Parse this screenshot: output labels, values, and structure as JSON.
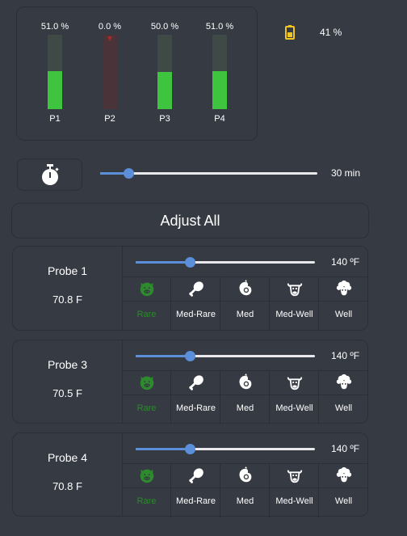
{
  "probe_bars": [
    {
      "name": "P1",
      "pct_label": "51.0 %",
      "level": 0.51,
      "enabled": true
    },
    {
      "name": "P2",
      "pct_label": "0.0 %",
      "level": 0.0,
      "enabled": false
    },
    {
      "name": "P3",
      "pct_label": "50.0 %",
      "level": 0.5,
      "enabled": true
    },
    {
      "name": "P4",
      "pct_label": "51.0 %",
      "level": 0.51,
      "enabled": true
    }
  ],
  "battery": {
    "icon": "battery-icon",
    "value": "41 %",
    "color": "#f2c61f"
  },
  "timer": {
    "icon": "stopwatch-icon",
    "value": "30 min",
    "level": 0.13
  },
  "adjust_all_label": "Adjust All",
  "probes": [
    {
      "name": "Probe 1",
      "temp": "70.8 F",
      "target": "140 ºF",
      "level": 0.3,
      "doneness": [
        {
          "label": "Rare",
          "icon": "pig-icon"
        },
        {
          "label": "Med-Rare",
          "icon": "drumstick-icon"
        },
        {
          "label": "Med",
          "icon": "chicken-icon"
        },
        {
          "label": "Med-Well",
          "icon": "cow-icon"
        },
        {
          "label": "Well",
          "icon": "sheep-icon"
        }
      ]
    },
    {
      "name": "Probe 3",
      "temp": "70.5 F",
      "target": "140 ºF",
      "level": 0.3,
      "doneness": [
        {
          "label": "Rare",
          "icon": "pig-icon"
        },
        {
          "label": "Med-Rare",
          "icon": "drumstick-icon"
        },
        {
          "label": "Med",
          "icon": "chicken-icon"
        },
        {
          "label": "Med-Well",
          "icon": "cow-icon"
        },
        {
          "label": "Well",
          "icon": "sheep-icon"
        }
      ]
    },
    {
      "name": "Probe 4",
      "temp": "70.8 F",
      "target": "140 ºF",
      "level": 0.3,
      "doneness": [
        {
          "label": "Rare",
          "icon": "pig-icon"
        },
        {
          "label": "Med-Rare",
          "icon": "drumstick-icon"
        },
        {
          "label": "Med",
          "icon": "chicken-icon"
        },
        {
          "label": "Med-Well",
          "icon": "cow-icon"
        },
        {
          "label": "Well",
          "icon": "sheep-icon"
        }
      ]
    }
  ],
  "colors": {
    "accent": "#5b8fd9",
    "bar_green": "#3ec43f",
    "active_green": "#2d8a2d"
  }
}
